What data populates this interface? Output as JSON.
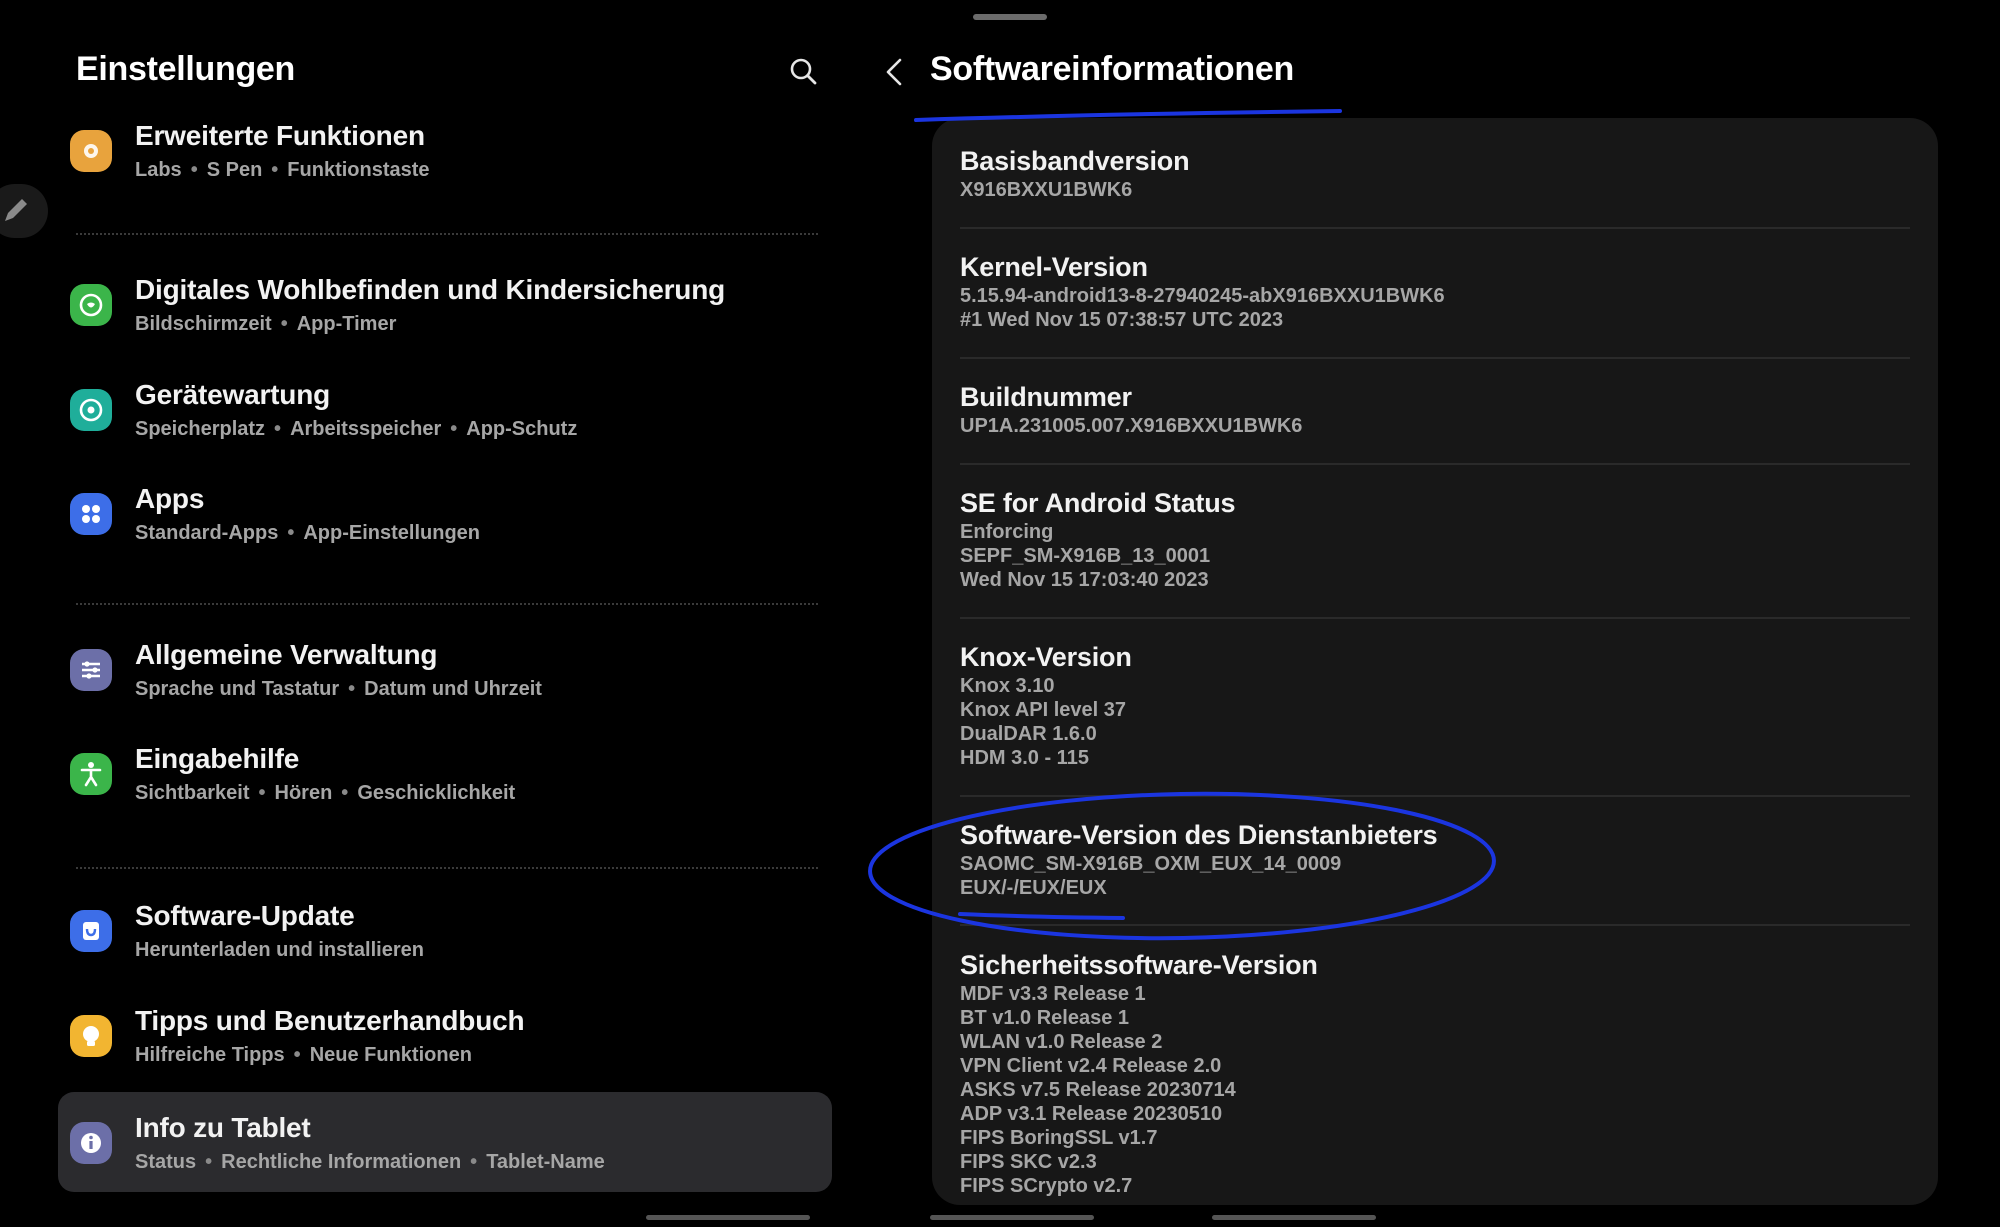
{
  "left": {
    "title": "Einstellungen",
    "items": [
      {
        "label": "Erweiterte Funktionen",
        "sub": [
          "Labs",
          "S Pen",
          "Funktionstaste"
        ],
        "icon": "advanced-features-icon",
        "color": "#e8a33d"
      },
      {
        "label": "Digitales Wohlbefinden und Kindersicherung",
        "sub": [
          "Bildschirmzeit",
          "App-Timer"
        ],
        "icon": "digital-wellbeing-icon",
        "color": "#3bb54a"
      },
      {
        "label": "Gerätewartung",
        "sub": [
          "Speicherplatz",
          "Arbeitsspeicher",
          "App-Schutz"
        ],
        "icon": "device-care-icon",
        "color": "#1fae9a"
      },
      {
        "label": "Apps",
        "sub": [
          "Standard-Apps",
          "App-Einstellungen"
        ],
        "icon": "apps-icon",
        "color": "#3d6ee8"
      },
      {
        "label": "Allgemeine Verwaltung",
        "sub": [
          "Sprache und Tastatur",
          "Datum und Uhrzeit"
        ],
        "icon": "general-management-icon",
        "color": "#6c6fa8"
      },
      {
        "label": "Eingabehilfe",
        "sub": [
          "Sichtbarkeit",
          "Hören",
          "Geschicklichkeit"
        ],
        "icon": "accessibility-icon",
        "color": "#3bb54a"
      },
      {
        "label": "Software-Update",
        "sub": [
          "Herunterladen und installieren"
        ],
        "icon": "software-update-icon",
        "color": "#3d6ee8"
      },
      {
        "label": "Tipps und Benutzerhandbuch",
        "sub": [
          "Hilfreiche Tipps",
          "Neue Funktionen"
        ],
        "icon": "tips-icon",
        "color": "#f2b531"
      },
      {
        "label": "Info zu Tablet",
        "sub": [
          "Status",
          "Rechtliche Informationen",
          "Tablet-Name"
        ],
        "icon": "info-icon",
        "color": "#6c6fa8"
      }
    ]
  },
  "right": {
    "title": "Softwareinformationen",
    "rows": [
      {
        "label": "Basisbandversion",
        "values": [
          "X916BXXU1BWK6"
        ]
      },
      {
        "label": "Kernel-Version",
        "values": [
          "5.15.94-android13-8-27940245-abX916BXXU1BWK6",
          "#1 Wed Nov 15 07:38:57 UTC 2023"
        ]
      },
      {
        "label": "Buildnummer",
        "values": [
          "UP1A.231005.007.X916BXXU1BWK6"
        ]
      },
      {
        "label": "SE for Android Status",
        "values": [
          "Enforcing",
          "SEPF_SM-X916B_13_0001",
          "Wed Nov 15 17:03:40 2023"
        ]
      },
      {
        "label": "Knox-Version",
        "values": [
          "Knox 3.10",
          "Knox API level 37",
          "DualDAR 1.6.0",
          "HDM 3.0 - 115"
        ]
      },
      {
        "label": "Software-Version des Dienstanbieters",
        "values": [
          "SAOMC_SM-X916B_OXM_EUX_14_0009",
          "EUX/-/EUX/EUX"
        ]
      },
      {
        "label": "Sicherheitssoftware-Version",
        "values": [
          "MDF v3.3 Release 1",
          "BT v1.0 Release 1",
          "WLAN v1.0 Release 2",
          "VPN Client v2.4 Release 2.0",
          "ASKS v7.5  Release 20230714",
          "ADP v3.1 Release 20230510",
          "FIPS BoringSSL v1.7",
          "FIPS SKC v2.3",
          "FIPS SCrypto v2.7"
        ]
      }
    ]
  },
  "colors": {
    "background": "#000000",
    "card": "#171717",
    "selected": "#2b2b2e",
    "annotation": "#1b35e0"
  }
}
